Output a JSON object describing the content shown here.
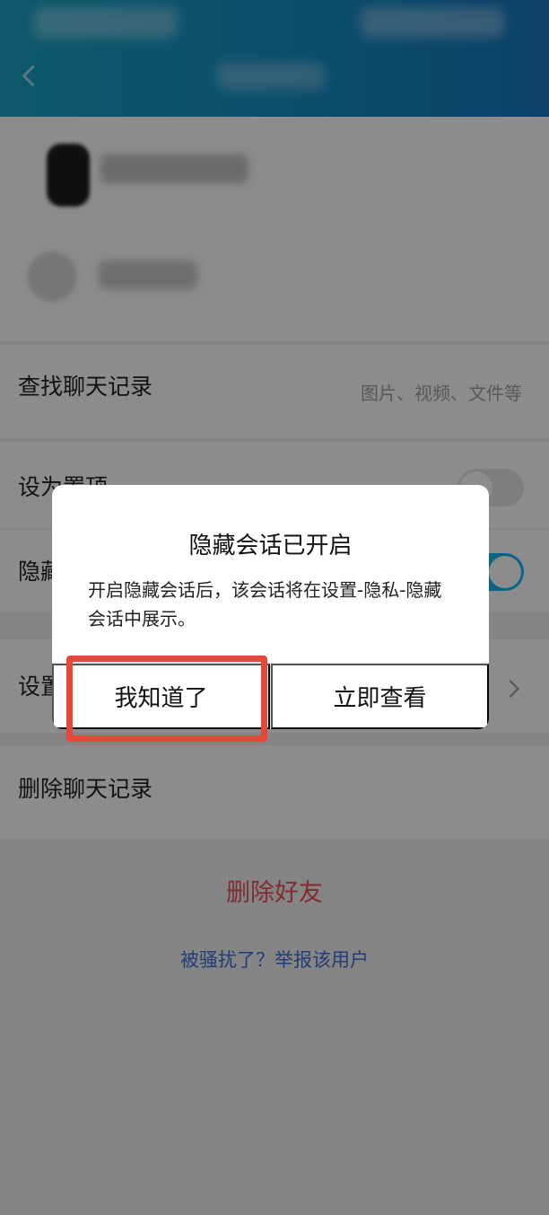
{
  "settings": {
    "search_history_label": "查找聊天记录",
    "search_history_hint": "图片、视频、文件等",
    "pin_label": "设为置顶",
    "hide_label": "隐藏会话",
    "set_label": "设置",
    "delete_history_label": "删除聊天记录",
    "delete_friend_label": "删除好友",
    "report_link": "被骚扰了？举报该用户"
  },
  "dialog": {
    "title": "隐藏会话已开启",
    "message": "开启隐藏会话后，该会话将在设置-隐私-隐藏会话中展示。",
    "ok_button": "我知道了",
    "view_button": "立即查看"
  },
  "colors": {
    "header_gradient_start": "#18a3c4",
    "header_gradient_end": "#1575c0",
    "toggle_on": "#12b7f5",
    "danger": "#e8525a",
    "link": "#3c6fd8",
    "highlight": "#e8473a"
  },
  "icons": {
    "back": "back-arrow-icon",
    "chevron": "chevron-right-icon"
  }
}
